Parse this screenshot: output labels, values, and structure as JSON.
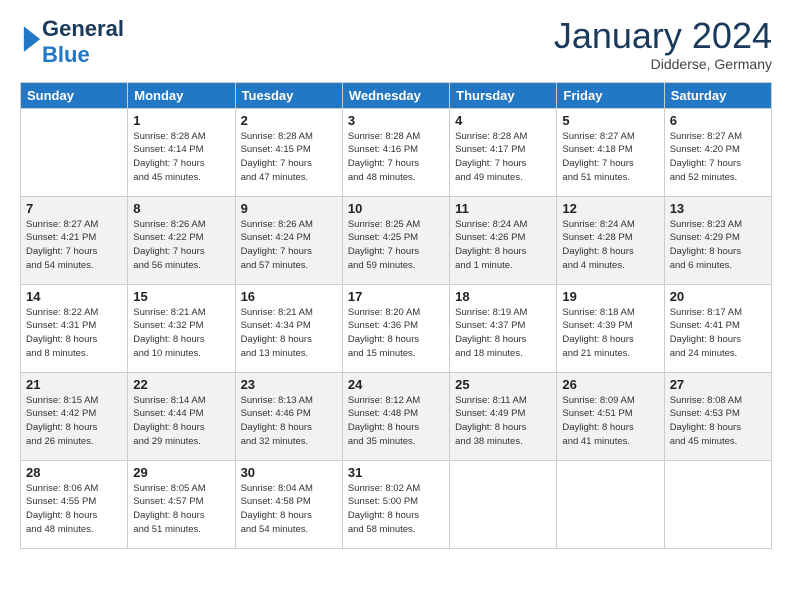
{
  "logo": {
    "general": "General",
    "blue": "Blue"
  },
  "header": {
    "month": "January 2024",
    "location": "Didderse, Germany"
  },
  "weekdays": [
    "Sunday",
    "Monday",
    "Tuesday",
    "Wednesday",
    "Thursday",
    "Friday",
    "Saturday"
  ],
  "weeks": [
    [
      {
        "day": "",
        "info": ""
      },
      {
        "day": "1",
        "info": "Sunrise: 8:28 AM\nSunset: 4:14 PM\nDaylight: 7 hours\nand 45 minutes."
      },
      {
        "day": "2",
        "info": "Sunrise: 8:28 AM\nSunset: 4:15 PM\nDaylight: 7 hours\nand 47 minutes."
      },
      {
        "day": "3",
        "info": "Sunrise: 8:28 AM\nSunset: 4:16 PM\nDaylight: 7 hours\nand 48 minutes."
      },
      {
        "day": "4",
        "info": "Sunrise: 8:28 AM\nSunset: 4:17 PM\nDaylight: 7 hours\nand 49 minutes."
      },
      {
        "day": "5",
        "info": "Sunrise: 8:27 AM\nSunset: 4:18 PM\nDaylight: 7 hours\nand 51 minutes."
      },
      {
        "day": "6",
        "info": "Sunrise: 8:27 AM\nSunset: 4:20 PM\nDaylight: 7 hours\nand 52 minutes."
      }
    ],
    [
      {
        "day": "7",
        "info": "Sunrise: 8:27 AM\nSunset: 4:21 PM\nDaylight: 7 hours\nand 54 minutes."
      },
      {
        "day": "8",
        "info": "Sunrise: 8:26 AM\nSunset: 4:22 PM\nDaylight: 7 hours\nand 56 minutes."
      },
      {
        "day": "9",
        "info": "Sunrise: 8:26 AM\nSunset: 4:24 PM\nDaylight: 7 hours\nand 57 minutes."
      },
      {
        "day": "10",
        "info": "Sunrise: 8:25 AM\nSunset: 4:25 PM\nDaylight: 7 hours\nand 59 minutes."
      },
      {
        "day": "11",
        "info": "Sunrise: 8:24 AM\nSunset: 4:26 PM\nDaylight: 8 hours\nand 1 minute."
      },
      {
        "day": "12",
        "info": "Sunrise: 8:24 AM\nSunset: 4:28 PM\nDaylight: 8 hours\nand 4 minutes."
      },
      {
        "day": "13",
        "info": "Sunrise: 8:23 AM\nSunset: 4:29 PM\nDaylight: 8 hours\nand 6 minutes."
      }
    ],
    [
      {
        "day": "14",
        "info": "Sunrise: 8:22 AM\nSunset: 4:31 PM\nDaylight: 8 hours\nand 8 minutes."
      },
      {
        "day": "15",
        "info": "Sunrise: 8:21 AM\nSunset: 4:32 PM\nDaylight: 8 hours\nand 10 minutes."
      },
      {
        "day": "16",
        "info": "Sunrise: 8:21 AM\nSunset: 4:34 PM\nDaylight: 8 hours\nand 13 minutes."
      },
      {
        "day": "17",
        "info": "Sunrise: 8:20 AM\nSunset: 4:36 PM\nDaylight: 8 hours\nand 15 minutes."
      },
      {
        "day": "18",
        "info": "Sunrise: 8:19 AM\nSunset: 4:37 PM\nDaylight: 8 hours\nand 18 minutes."
      },
      {
        "day": "19",
        "info": "Sunrise: 8:18 AM\nSunset: 4:39 PM\nDaylight: 8 hours\nand 21 minutes."
      },
      {
        "day": "20",
        "info": "Sunrise: 8:17 AM\nSunset: 4:41 PM\nDaylight: 8 hours\nand 24 minutes."
      }
    ],
    [
      {
        "day": "21",
        "info": "Sunrise: 8:15 AM\nSunset: 4:42 PM\nDaylight: 8 hours\nand 26 minutes."
      },
      {
        "day": "22",
        "info": "Sunrise: 8:14 AM\nSunset: 4:44 PM\nDaylight: 8 hours\nand 29 minutes."
      },
      {
        "day": "23",
        "info": "Sunrise: 8:13 AM\nSunset: 4:46 PM\nDaylight: 8 hours\nand 32 minutes."
      },
      {
        "day": "24",
        "info": "Sunrise: 8:12 AM\nSunset: 4:48 PM\nDaylight: 8 hours\nand 35 minutes."
      },
      {
        "day": "25",
        "info": "Sunrise: 8:11 AM\nSunset: 4:49 PM\nDaylight: 8 hours\nand 38 minutes."
      },
      {
        "day": "26",
        "info": "Sunrise: 8:09 AM\nSunset: 4:51 PM\nDaylight: 8 hours\nand 41 minutes."
      },
      {
        "day": "27",
        "info": "Sunrise: 8:08 AM\nSunset: 4:53 PM\nDaylight: 8 hours\nand 45 minutes."
      }
    ],
    [
      {
        "day": "28",
        "info": "Sunrise: 8:06 AM\nSunset: 4:55 PM\nDaylight: 8 hours\nand 48 minutes."
      },
      {
        "day": "29",
        "info": "Sunrise: 8:05 AM\nSunset: 4:57 PM\nDaylight: 8 hours\nand 51 minutes."
      },
      {
        "day": "30",
        "info": "Sunrise: 8:04 AM\nSunset: 4:58 PM\nDaylight: 8 hours\nand 54 minutes."
      },
      {
        "day": "31",
        "info": "Sunrise: 8:02 AM\nSunset: 5:00 PM\nDaylight: 8 hours\nand 58 minutes."
      },
      {
        "day": "",
        "info": ""
      },
      {
        "day": "",
        "info": ""
      },
      {
        "day": "",
        "info": ""
      }
    ]
  ]
}
